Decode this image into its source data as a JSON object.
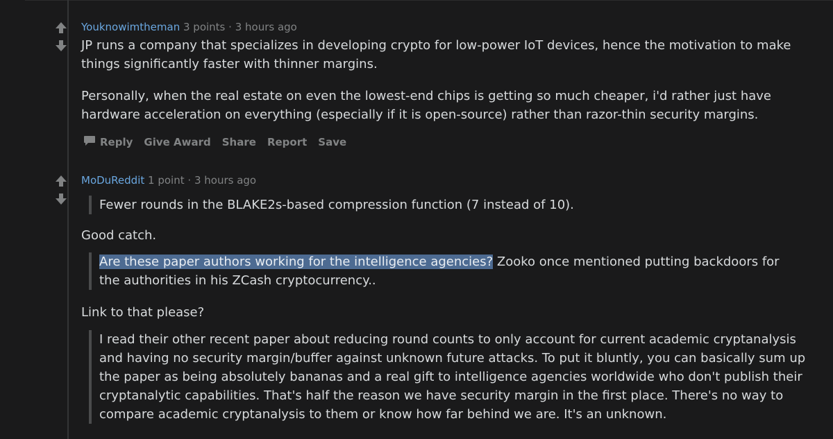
{
  "comments": [
    {
      "author": "Youknowimtheman",
      "points": "3 points",
      "separator": "·",
      "time": "3 hours ago",
      "paragraphs": [
        "JP runs a company that specializes in developing crypto for low-power IoT devices, hence the motivation to make things significantly faster with thinner margins.",
        "Personally, when the real estate on even the lowest-end chips is getting so much cheaper, i'd rather just have hardware acceleration on everything (especially if it is open-source) rather than razor-thin security margins."
      ],
      "actions": {
        "reply": "Reply",
        "give_award": "Give Award",
        "share": "Share",
        "report": "Report",
        "save": "Save"
      }
    },
    {
      "author": "MoDuReddit",
      "points": "1 point",
      "separator": "·",
      "time": "3 hours ago",
      "quote1": "Fewer rounds in the BLAKE2s-based compression function (7 instead of 10).",
      "text1": "Good catch.",
      "quote2_highlighted": "Are these paper authors working for the intelligence agencies?",
      "quote2_rest": " Zooko once mentioned putting backdoors for the authorities in his ZCash cryptocurrency..",
      "text2": "Link to that please?",
      "quote3": "I read their other recent paper about reducing round counts to only account for current academic cryptanalysis and having no security margin/buffer against unknown future attacks. To put it bluntly, you can basically sum up the paper as being absolutely bananas and a real gift to intelligence agencies worldwide who don't publish their cryptanalytic capabilities. That's half the reason we have security margin in the first place. There's no way to compare academic cryptanalysis to them or know how far behind we are. It's an unknown."
    }
  ],
  "icons": {
    "upvote": "arrow-up-icon",
    "downvote": "arrow-down-icon",
    "reply": "comment-bubble-icon"
  },
  "colors": {
    "background": "#1a1a1b",
    "author": "#6aa7e0",
    "meta": "#818384",
    "text": "#d7dadc",
    "highlight": "#4d6b92"
  }
}
